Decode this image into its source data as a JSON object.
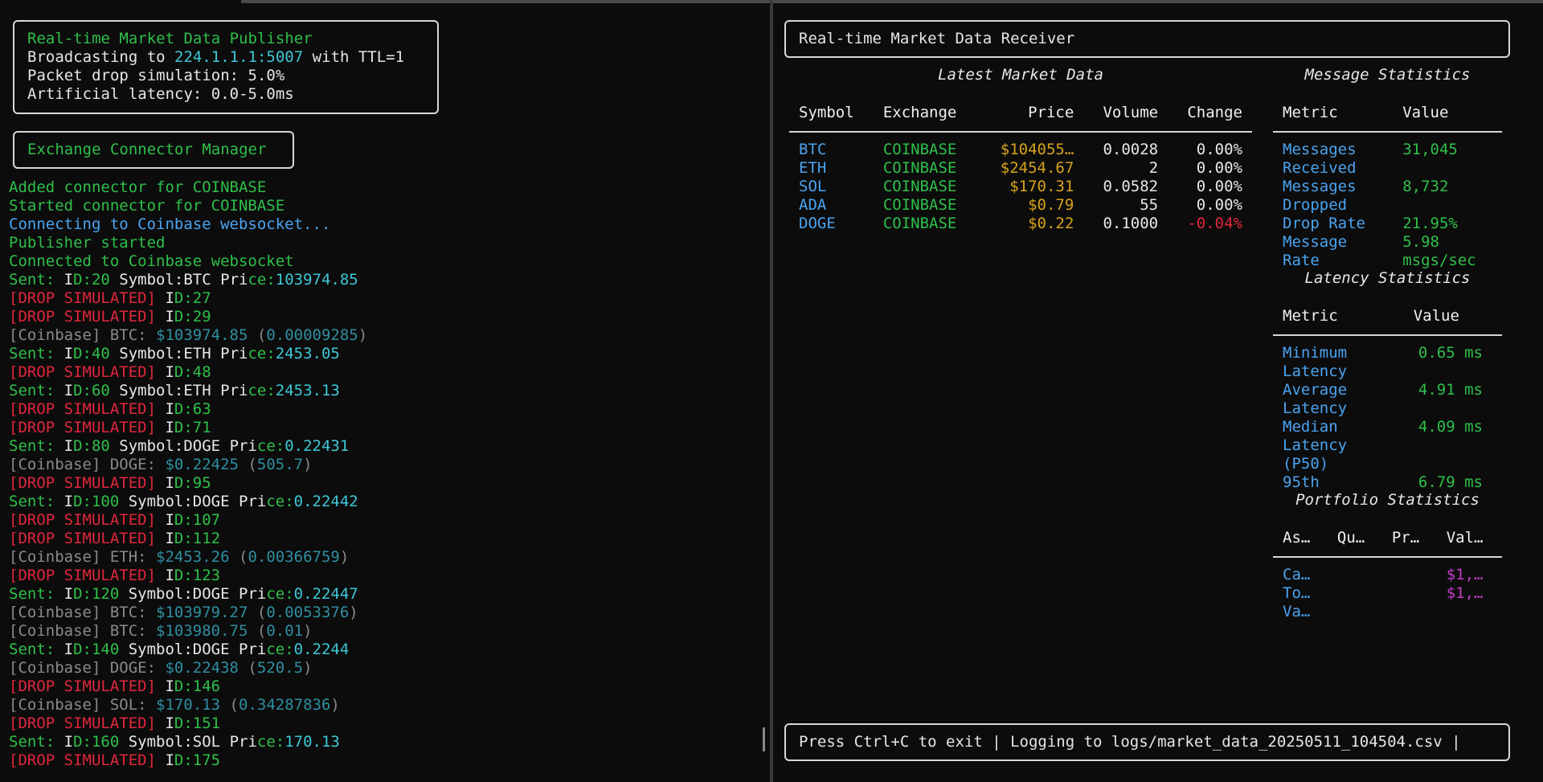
{
  "publisher": {
    "title": "Real-time Market Data Publisher",
    "broadcast_prefix": "Broadcasting to ",
    "broadcast_addr": "224.1.1.1:5007",
    "broadcast_suffix": " with TTL=1",
    "drop_line": "Packet drop simulation: 5.0%",
    "latency_line": "Artificial latency: 0.0-5.0ms"
  },
  "connector_title": "Exchange Connector Manager",
  "log_lines": [
    [
      {
        "t": "Added connector for COINBASE",
        "c": "g"
      }
    ],
    [
      {
        "t": "Started connector for COINBASE",
        "c": "g"
      }
    ],
    [
      {
        "t": "Connecting to Coinbase websocket...",
        "c": "bl"
      }
    ],
    [
      {
        "t": "Publisher started",
        "c": "g"
      }
    ],
    [
      {
        "t": "Connected to Coinbase websocket",
        "c": "g"
      }
    ],
    [
      {
        "t": "Sent: ",
        "c": "g"
      },
      {
        "t": "I",
        "c": "w"
      },
      {
        "t": "D:20 ",
        "c": "g"
      },
      {
        "t": "Symbol:BTC Pri",
        "c": "w"
      },
      {
        "t": "ce:",
        "c": "g"
      },
      {
        "t": "1039",
        "c": "cy"
      },
      {
        "t": "74.85",
        "c": "cy"
      }
    ],
    [
      {
        "t": "[DROP SIMULATED] ",
        "c": "r"
      },
      {
        "t": "I",
        "c": "w"
      },
      {
        "t": "D:27",
        "c": "g"
      }
    ],
    [
      {
        "t": "[DROP SIMULATED] ",
        "c": "r"
      },
      {
        "t": "I",
        "c": "w"
      },
      {
        "t": "D:29",
        "c": "g"
      }
    ],
    [
      {
        "t": "[Coinbase] BTC: ",
        "c": "gr"
      },
      {
        "t": "$103974.85",
        "c": "tl"
      },
      {
        "t": " (",
        "c": "gr"
      },
      {
        "t": "0.00009285",
        "c": "tl"
      },
      {
        "t": ")",
        "c": "gr"
      }
    ],
    [
      {
        "t": "Sent: ",
        "c": "g"
      },
      {
        "t": "I",
        "c": "w"
      },
      {
        "t": "D:40 ",
        "c": "g"
      },
      {
        "t": "Symbol:ETH Pri",
        "c": "w"
      },
      {
        "t": "ce:",
        "c": "g"
      },
      {
        "t": "2453.05",
        "c": "cy"
      }
    ],
    [
      {
        "t": "[DROP SIMULATED] ",
        "c": "r"
      },
      {
        "t": "I",
        "c": "w"
      },
      {
        "t": "D:48",
        "c": "g"
      }
    ],
    [
      {
        "t": "Sent: ",
        "c": "g"
      },
      {
        "t": "I",
        "c": "w"
      },
      {
        "t": "D:60 ",
        "c": "g"
      },
      {
        "t": "Symbol:ETH Pri",
        "c": "w"
      },
      {
        "t": "ce:",
        "c": "g"
      },
      {
        "t": "2453.13",
        "c": "cy"
      }
    ],
    [
      {
        "t": "[DROP SIMULATED] ",
        "c": "r"
      },
      {
        "t": "I",
        "c": "w"
      },
      {
        "t": "D:63",
        "c": "g"
      }
    ],
    [
      {
        "t": "[DROP SIMULATED] ",
        "c": "r"
      },
      {
        "t": "I",
        "c": "w"
      },
      {
        "t": "D:71",
        "c": "g"
      }
    ],
    [
      {
        "t": "Sent: ",
        "c": "g"
      },
      {
        "t": "I",
        "c": "w"
      },
      {
        "t": "D:80 ",
        "c": "g"
      },
      {
        "t": "Symbol:DOGE Pri",
        "c": "w"
      },
      {
        "t": "ce:",
        "c": "g"
      },
      {
        "t": "0.22431",
        "c": "cy"
      }
    ],
    [
      {
        "t": "[Coinbase] DOGE: ",
        "c": "gr"
      },
      {
        "t": "$0.22425",
        "c": "tl"
      },
      {
        "t": " (",
        "c": "gr"
      },
      {
        "t": "505.7",
        "c": "tl"
      },
      {
        "t": ")",
        "c": "gr"
      }
    ],
    [
      {
        "t": "[DROP SIMULATED] ",
        "c": "r"
      },
      {
        "t": "I",
        "c": "w"
      },
      {
        "t": "D:95",
        "c": "g"
      }
    ],
    [
      {
        "t": "Sent: ",
        "c": "g"
      },
      {
        "t": "I",
        "c": "w"
      },
      {
        "t": "D:100 ",
        "c": "g"
      },
      {
        "t": "Symbol:DOGE Pri",
        "c": "w"
      },
      {
        "t": "ce:",
        "c": "g"
      },
      {
        "t": "0.22442",
        "c": "cy"
      }
    ],
    [
      {
        "t": "[DROP SIMULATED] ",
        "c": "r"
      },
      {
        "t": "I",
        "c": "w"
      },
      {
        "t": "D:107",
        "c": "g"
      }
    ],
    [
      {
        "t": "[DROP SIMULATED] ",
        "c": "r"
      },
      {
        "t": "I",
        "c": "w"
      },
      {
        "t": "D:112",
        "c": "g"
      }
    ],
    [
      {
        "t": "[Coinbase] ETH: ",
        "c": "gr"
      },
      {
        "t": "$2453.26",
        "c": "tl"
      },
      {
        "t": " (",
        "c": "gr"
      },
      {
        "t": "0.00366759",
        "c": "tl"
      },
      {
        "t": ")",
        "c": "gr"
      }
    ],
    [
      {
        "t": "[DROP SIMULATED] ",
        "c": "r"
      },
      {
        "t": "I",
        "c": "w"
      },
      {
        "t": "D:123",
        "c": "g"
      }
    ],
    [
      {
        "t": "Sent: ",
        "c": "g"
      },
      {
        "t": "I",
        "c": "w"
      },
      {
        "t": "D:120 ",
        "c": "g"
      },
      {
        "t": "Symbol:DOGE Pri",
        "c": "w"
      },
      {
        "t": "ce:",
        "c": "g"
      },
      {
        "t": "0.22447",
        "c": "cy"
      }
    ],
    [
      {
        "t": "[Coinbase] BTC: ",
        "c": "gr"
      },
      {
        "t": "$103979.27",
        "c": "tl"
      },
      {
        "t": " (",
        "c": "gr"
      },
      {
        "t": "0.0053376",
        "c": "tl"
      },
      {
        "t": ")",
        "c": "gr"
      }
    ],
    [
      {
        "t": "[Coinbase] BTC: ",
        "c": "gr"
      },
      {
        "t": "$103980.75",
        "c": "tl"
      },
      {
        "t": " (",
        "c": "gr"
      },
      {
        "t": "0.01",
        "c": "tl"
      },
      {
        "t": ")",
        "c": "gr"
      }
    ],
    [
      {
        "t": "Sent: ",
        "c": "g"
      },
      {
        "t": "I",
        "c": "w"
      },
      {
        "t": "D:140 ",
        "c": "g"
      },
      {
        "t": "Symbol:DOGE Pri",
        "c": "w"
      },
      {
        "t": "ce:",
        "c": "g"
      },
      {
        "t": "0.2244",
        "c": "cy"
      }
    ],
    [
      {
        "t": "[Coinbase] DOGE: ",
        "c": "gr"
      },
      {
        "t": "$0.22438",
        "c": "tl"
      },
      {
        "t": " (",
        "c": "gr"
      },
      {
        "t": "520.5",
        "c": "tl"
      },
      {
        "t": ")",
        "c": "gr"
      }
    ],
    [
      {
        "t": "[DROP SIMULATED] ",
        "c": "r"
      },
      {
        "t": "I",
        "c": "w"
      },
      {
        "t": "D:146",
        "c": "g"
      }
    ],
    [
      {
        "t": "[Coinbase] SOL: ",
        "c": "gr"
      },
      {
        "t": "$170.13",
        "c": "tl"
      },
      {
        "t": " (",
        "c": "gr"
      },
      {
        "t": "0.34287836",
        "c": "tl"
      },
      {
        "t": ")",
        "c": "gr"
      }
    ],
    [
      {
        "t": "[DROP SIMULATED] ",
        "c": "r"
      },
      {
        "t": "I",
        "c": "w"
      },
      {
        "t": "D:151",
        "c": "g"
      }
    ],
    [
      {
        "t": "Sent: ",
        "c": "g"
      },
      {
        "t": "I",
        "c": "w"
      },
      {
        "t": "D:160 ",
        "c": "g"
      },
      {
        "t": "Symbol:SOL Pri",
        "c": "w"
      },
      {
        "t": "ce:",
        "c": "g"
      },
      {
        "t": "170.13",
        "c": "cy"
      }
    ],
    [
      {
        "t": "[DROP SIMULATED] ",
        "c": "r"
      },
      {
        "t": "I",
        "c": "w"
      },
      {
        "t": "D:175",
        "c": "g"
      }
    ]
  ],
  "receiver": {
    "title": "Real-time Market Data Receiver",
    "market": {
      "title": "Latest Market Data",
      "headers": [
        "Symbol",
        "Exchange",
        "Price",
        "Volume",
        "Change"
      ],
      "rows": [
        {
          "symbol": "BTC",
          "exchange": "COINBASE",
          "price": "$104055…",
          "volume": "0.0028",
          "change": "0.00%",
          "neg": false
        },
        {
          "symbol": "ETH",
          "exchange": "COINBASE",
          "price": "$2454.67",
          "volume": "2",
          "change": "0.00%",
          "neg": false
        },
        {
          "symbol": "SOL",
          "exchange": "COINBASE",
          "price": "$170.31",
          "volume": "0.0582",
          "change": "0.00%",
          "neg": false
        },
        {
          "symbol": "ADA",
          "exchange": "COINBASE",
          "price": "$0.79",
          "volume": "55",
          "change": "0.00%",
          "neg": false
        },
        {
          "symbol": "DOGE",
          "exchange": "COINBASE",
          "price": "$0.22",
          "volume": "0.1000",
          "change": "-0.04%",
          "neg": true
        }
      ]
    },
    "messages": {
      "title": "Message Statistics",
      "headers": [
        "Metric",
        "Value"
      ],
      "rows": [
        {
          "metric": [
            "Messages",
            "Received"
          ],
          "value": [
            "31,045"
          ]
        },
        {
          "metric": [
            "Messages",
            "Dropped"
          ],
          "value": [
            "8,732"
          ]
        },
        {
          "metric": [
            "Drop Rate"
          ],
          "value": [
            "21.95%"
          ]
        },
        {
          "metric": [
            "Message",
            "Rate"
          ],
          "value": [
            "5.98",
            "msgs/sec"
          ]
        }
      ]
    },
    "latency": {
      "title": "Latency Statistics",
      "headers": [
        "Metric",
        "Value"
      ],
      "rows": [
        {
          "metric": [
            "Minimum",
            "Latency"
          ],
          "value": [
            "0.65 ms"
          ]
        },
        {
          "metric": [
            "Average",
            "Latency"
          ],
          "value": [
            "4.91 ms"
          ]
        },
        {
          "metric": [
            "Median",
            "Latency",
            "(P50)"
          ],
          "value": [
            "4.09 ms"
          ]
        },
        {
          "metric": [
            "95th"
          ],
          "value": [
            "6.79 ms"
          ]
        }
      ]
    },
    "portfolio": {
      "title": "Portfolio Statistics",
      "headers": [
        "As…",
        "Qu…",
        "Pr…",
        "Val…"
      ],
      "rows": [
        {
          "asset": "Ca…",
          "value": "$1,…"
        },
        {
          "asset": "To…",
          "value": "$1,…"
        },
        {
          "asset": "Va…",
          "value": ""
        }
      ]
    },
    "footer": "Press Ctrl+C to exit | Logging to logs/market_data_20250511_104504.csv |"
  }
}
